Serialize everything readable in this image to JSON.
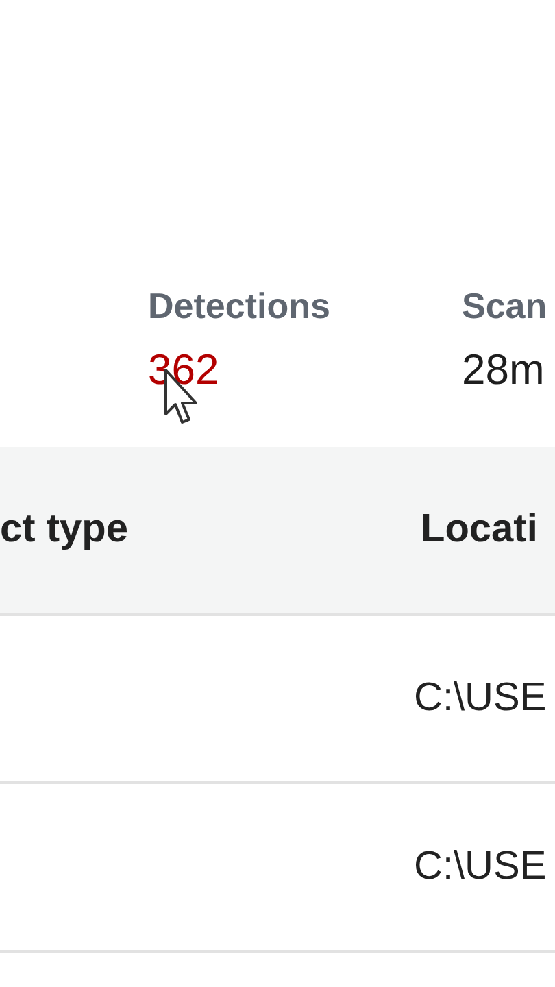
{
  "stats": [
    {
      "label": "Detections",
      "value": "362",
      "alert": true
    },
    {
      "label": "Scan",
      "value": "28m",
      "alert": false
    }
  ],
  "table": {
    "columns": [
      "ct type",
      "Locati"
    ],
    "rows": [
      {
        "column_2": "C:\\USE"
      },
      {
        "column_2": "C:\\USE"
      }
    ]
  }
}
